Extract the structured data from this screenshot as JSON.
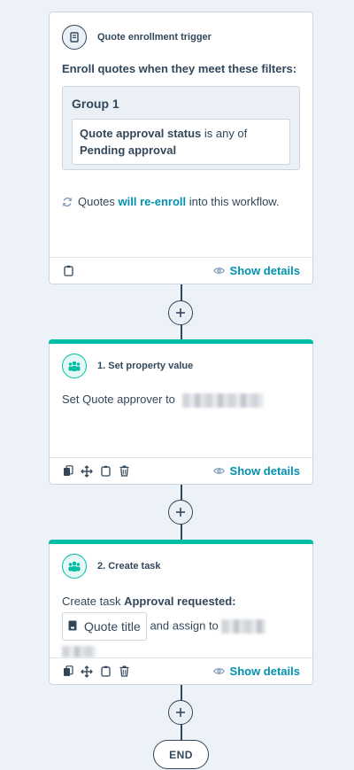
{
  "trigger": {
    "title": "Quote enrollment trigger",
    "enroll_label": "Enroll quotes when they meet these filters:",
    "group_label": "Group 1",
    "filter_property": "Quote approval status",
    "filter_operator": " is any of",
    "filter_value": "Pending approval",
    "reenroll_prefix": "Quotes ",
    "reenroll_link": "will re-enroll",
    "reenroll_suffix": " into this workflow.",
    "show_details": "Show details"
  },
  "actions": [
    {
      "title": "1. Set property value",
      "body_prefix": "Set Quote approver to",
      "show_details": "Show details"
    },
    {
      "title": "2. Create task",
      "body_prefix": "Create task ",
      "task_name": "Approval requested:",
      "token_label": "Quote title",
      "assign_text": "and assign to",
      "show_details": "Show details"
    }
  ],
  "end_label": "END",
  "colors": {
    "accent": "#00bda5",
    "link": "#0091ae",
    "text": "#33475b"
  }
}
